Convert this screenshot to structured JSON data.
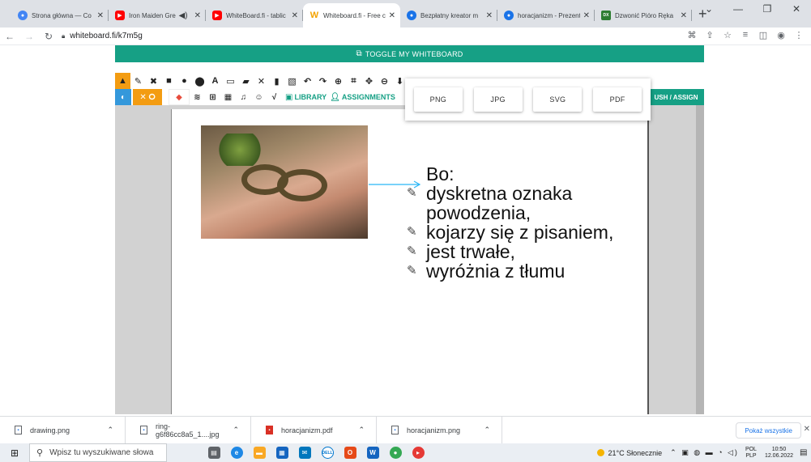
{
  "browser": {
    "tabs": [
      {
        "title": "Strona główna — Co",
        "favicon_color": "#4285f4",
        "favicon_glyph": "●"
      },
      {
        "title": "Iron Maiden Grea",
        "favicon_color": "#ff0000",
        "favicon_glyph": "▶",
        "audio_icon": "speaker-icon"
      },
      {
        "title": "WhiteBoard.fi - tablic",
        "favicon_color": "#ff0000",
        "favicon_glyph": "▶"
      },
      {
        "title": "Whiteboard.fi - Free c",
        "favicon_color": "#f4a300",
        "favicon_glyph": "W",
        "active": true
      },
      {
        "title": "Bezpłatny kreator m",
        "favicon_color": "#1a73e8",
        "favicon_glyph": "●"
      },
      {
        "title": "horacjanizm - Prezent",
        "favicon_color": "#1a73e8",
        "favicon_glyph": "●"
      },
      {
        "title": "Dzwonić Pióro Ręka",
        "favicon_color": "#2e7d32",
        "favicon_glyph": "DX"
      }
    ],
    "close_glyph": "✕",
    "new_tab": "+",
    "window_controls": [
      "⌄",
      "—",
      "❐",
      "✕"
    ],
    "url": "whiteboard.fi/k7m5g"
  },
  "app": {
    "toggle_label": "TOGGLE MY WHITEBOARD",
    "toolbar_tools": [
      "▲",
      "✎",
      "✖",
      "■",
      "●",
      "⬤",
      "A",
      "▭",
      "▰",
      "✕",
      "▮",
      "▧",
      "↶",
      "↷",
      "⊕",
      "⌗",
      "✥",
      "⊖",
      "⬇"
    ],
    "toolbar2": {
      "palette_glyph": "◐",
      "xo_label": "✕ ⭘",
      "eraser_glyph": "◆",
      "icons": [
        "≋",
        "⊞",
        "▦",
        "♫",
        "☺",
        "√"
      ],
      "library_label": "LIBRARY",
      "assignments_label": "ASSIGNMENTS"
    },
    "publish_label": "USH / ASSIGN",
    "export_options": [
      "PNG",
      "JPG",
      "SVG",
      "PDF"
    ],
    "notes": {
      "heading": "Bo:",
      "items": [
        "dyskretna oznaka",
        "powodzenia,",
        "kojarzy się z pisaniem,",
        "jest trwałe,",
        "wyróżnia z tłumu"
      ],
      "bullet_icon": "pencil-icon",
      "connector_color": "#29b6f6"
    },
    "accent_color": "#16a085"
  },
  "downloads": {
    "items": [
      "drawing.png",
      "ring-g6f86cc8a5_1....jpg",
      "horacjanizm.pdf",
      "horacjanizm.png"
    ],
    "show_all": "Pokaż wszystkie"
  },
  "taskbar": {
    "search_placeholder": "Wpisz tu wyszukiwane słowa",
    "weather": "21°C Słonecznie",
    "lang": "POL",
    "lang2": "PLP",
    "time": "10:50",
    "date": "12.06.2022"
  }
}
